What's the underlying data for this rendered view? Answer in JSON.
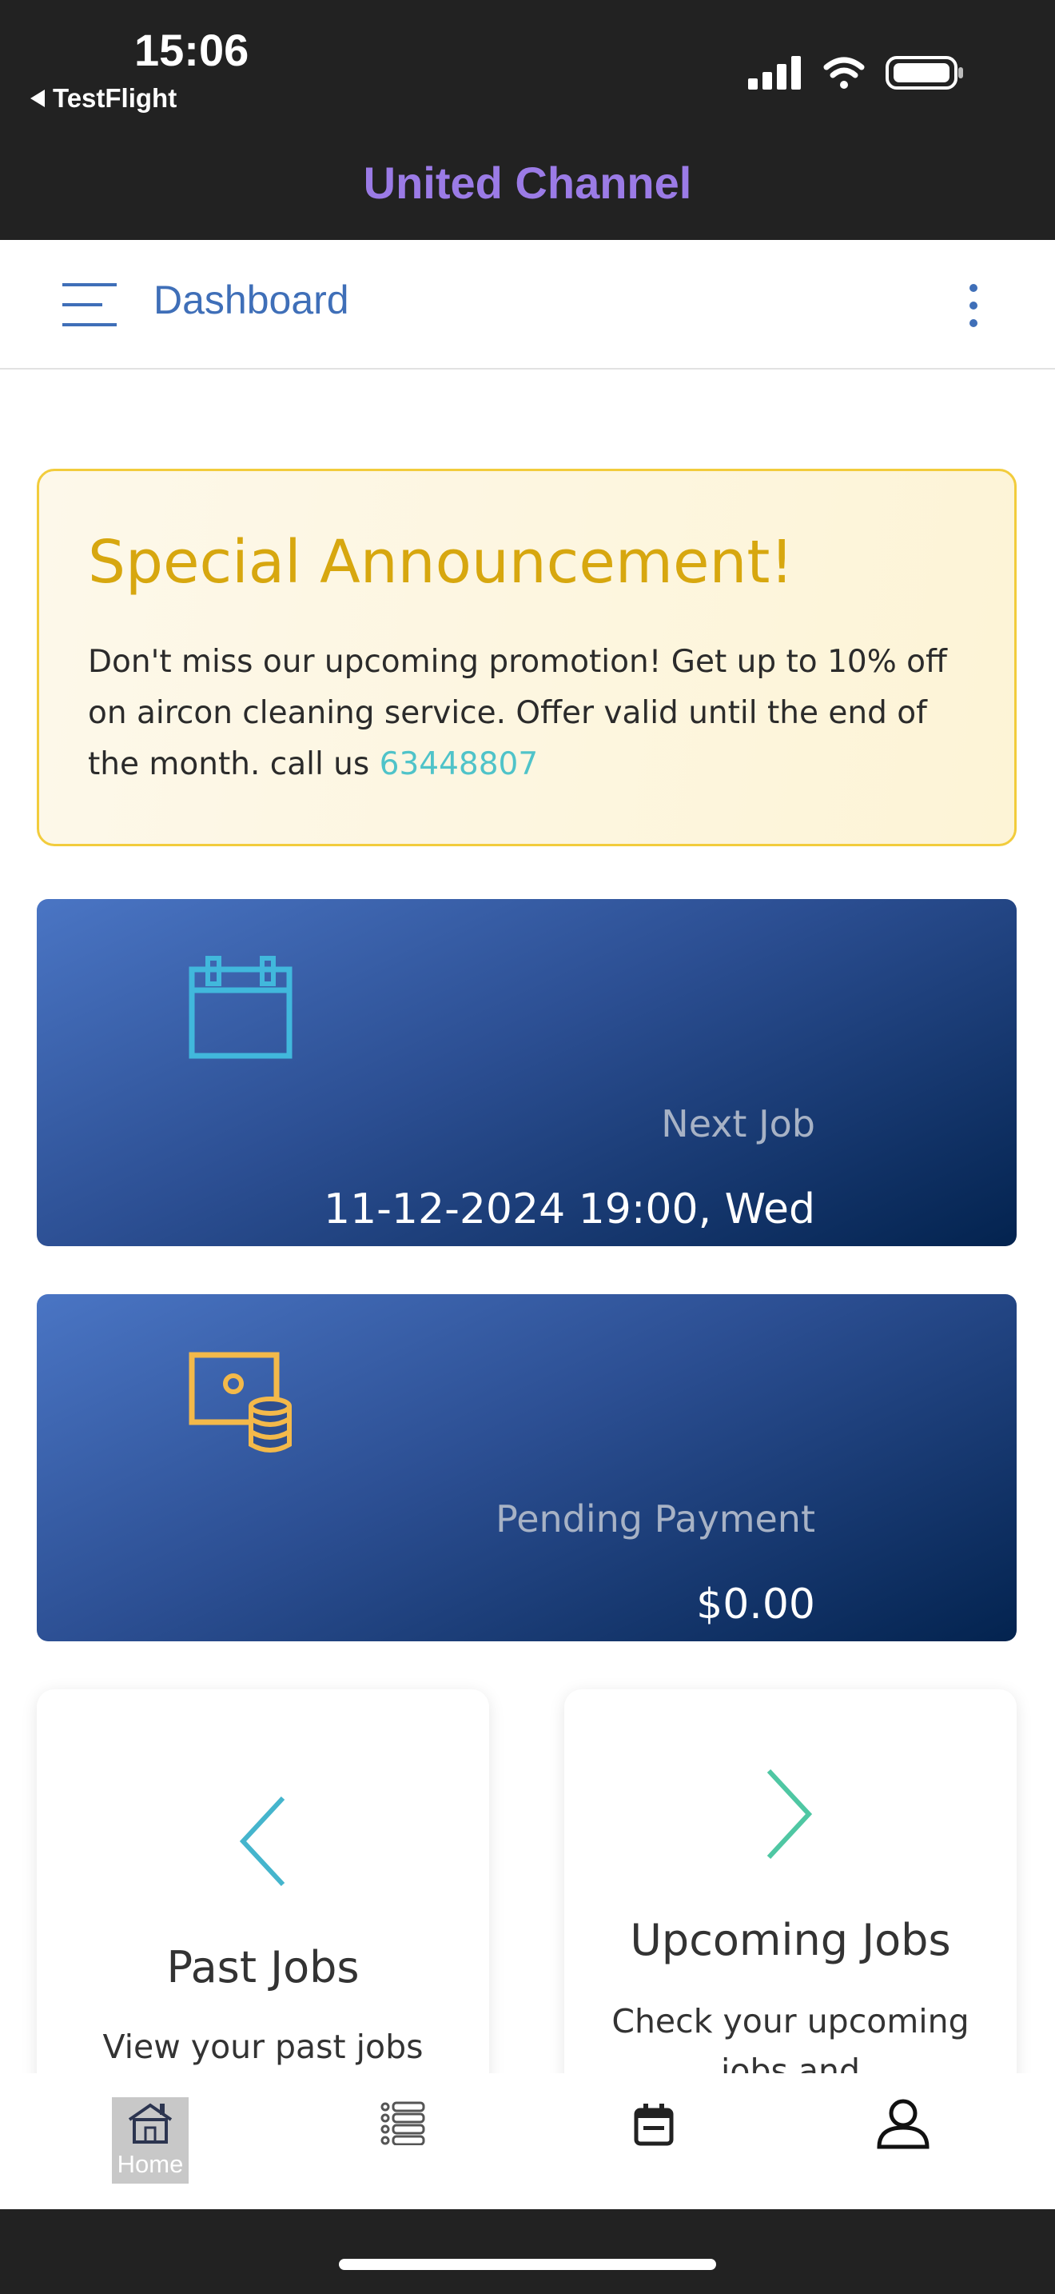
{
  "status_bar": {
    "time": "15:06",
    "back_app": "TestFlight"
  },
  "app": {
    "title": "United Channel"
  },
  "navbar": {
    "title": "Dashboard"
  },
  "announcement": {
    "title": "Special Announcement!",
    "body": "Don't miss our upcoming promotion! Get up to 10% off on aircon cleaning service. Offer valid until the end of the month. call us ",
    "phone": "63448807"
  },
  "next_job": {
    "label": "Next Job",
    "value": "11-12-2024 19:00, Wed",
    "icon": "calendar-icon"
  },
  "pending_payment": {
    "label": "Pending Payment",
    "value": "$0.00",
    "icon": "payment-icon"
  },
  "past_jobs": {
    "title": "Past Jobs",
    "description": "View your past jobs"
  },
  "upcoming_jobs": {
    "title": "Upcoming Jobs",
    "description": "Check your upcoming jobs and"
  },
  "tabs": [
    {
      "label": "Home",
      "icon": "home-icon",
      "active": true
    },
    {
      "label": "",
      "icon": "list-icon",
      "active": false
    },
    {
      "label": "",
      "icon": "calendar-icon",
      "active": false
    },
    {
      "label": "",
      "icon": "profile-icon",
      "active": false
    }
  ],
  "colors": {
    "header_bg": "#222222",
    "brand_title": "#9b7be6",
    "nav_text": "#3f6fb8",
    "announcement_title": "#d7a70f",
    "phone_link": "#4fc3c9",
    "card_gradient_start": "#4a75c4",
    "card_gradient_end": "#03234f"
  }
}
